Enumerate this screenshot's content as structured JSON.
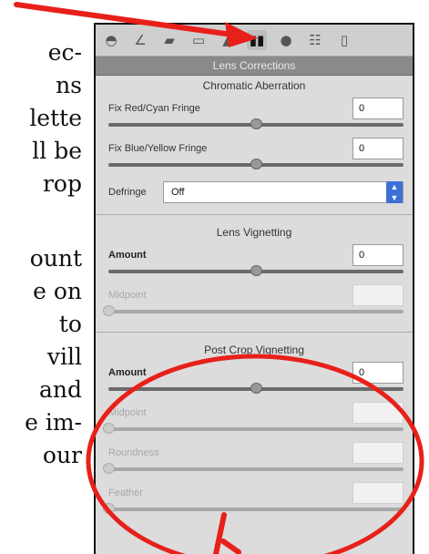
{
  "book_text": {
    "lines": [
      "ec-",
      "ns",
      "lette",
      "ll be",
      "rop"
    ],
    "lines2": [
      "ount",
      "e on",
      "to",
      "vill",
      "and",
      "e im-",
      "our"
    ]
  },
  "toolbar": {
    "tools": [
      {
        "icon": "aperture-icon",
        "glyph": "◓",
        "active": false
      },
      {
        "icon": "curve-icon",
        "glyph": "∠",
        "active": false
      },
      {
        "icon": "hsl-icon",
        "glyph": "▰",
        "active": false
      },
      {
        "icon": "split-tone-icon",
        "glyph": "▭",
        "active": false
      },
      {
        "icon": "detail-icon",
        "glyph": "▲",
        "active": false
      },
      {
        "icon": "lens-corrections-icon",
        "glyph": "▮▮",
        "active": true
      },
      {
        "icon": "camera-calibration-icon",
        "glyph": "●",
        "active": false
      },
      {
        "icon": "presets-icon",
        "glyph": "☷",
        "active": false
      },
      {
        "icon": "snapshot-icon",
        "glyph": "▯",
        "active": false
      }
    ]
  },
  "panel": {
    "title": "Lens Corrections",
    "chromatic": {
      "heading": "Chromatic Aberration",
      "red_cyan": {
        "label": "Fix Red/Cyan Fringe",
        "value": "0",
        "level": 0.5
      },
      "blue_yellow": {
        "label": "Fix Blue/Yellow Fringe",
        "value": "0",
        "level": 0.5
      },
      "defringe": {
        "label": "Defringe",
        "selected": "Off"
      }
    },
    "vignetting": {
      "heading": "Lens Vignetting",
      "amount": {
        "label": "Amount",
        "value": "0",
        "level": 0.5
      },
      "midpoint": {
        "label": "Midpoint",
        "value": "",
        "level": 0.0
      }
    },
    "post_crop": {
      "heading": "Post Crop Vignetting",
      "amount": {
        "label": "Amount",
        "value": "0",
        "level": 0.5
      },
      "midpoint": {
        "label": "Midpoint",
        "value": "",
        "level": 0.0
      },
      "roundness": {
        "label": "Roundness",
        "value": "",
        "level": 0.0
      },
      "feather": {
        "label": "Feather",
        "value": "",
        "level": 0.0
      }
    }
  },
  "colors": {
    "annotation": "#e8201a",
    "select_accent": "#3b6fd6"
  }
}
